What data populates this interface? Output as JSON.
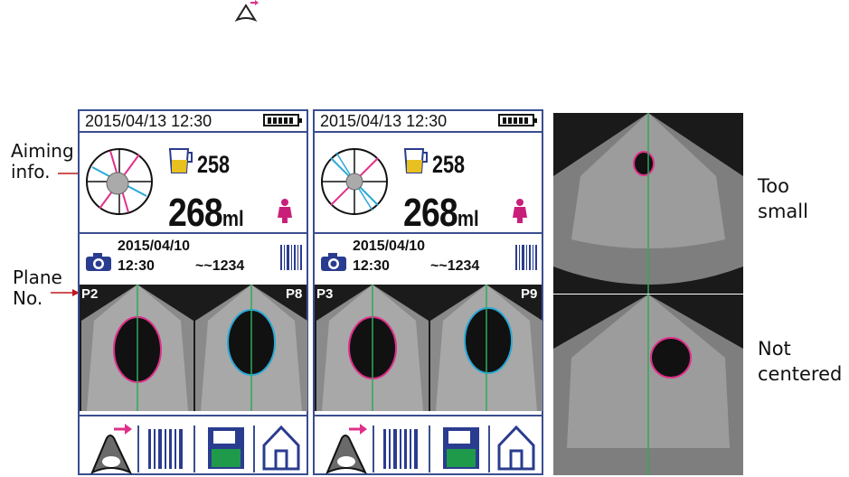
{
  "top_icon": "export-probe-icon",
  "labels": {
    "aiming_line1": "Aiming",
    "aiming_line2": "info.",
    "plane_line1": "Plane",
    "plane_line2": "No.",
    "too_small_line1": "Too",
    "too_small_line2": "small",
    "not_centered_line1": "Not",
    "not_centered_line2": "centered"
  },
  "screens": [
    {
      "datetime": "2015/04/13 12:30",
      "battery_bars": 5,
      "bladder_volume_small": "258",
      "volume_value": "268",
      "volume_unit": "ml",
      "measure_date": "2015/04/10",
      "measure_time": "12:30",
      "patient_id": "~~1234",
      "plane_left": "P2",
      "plane_right": "P8",
      "toolbar": [
        "export-probe-icon",
        "barcode-icon",
        "save-icon",
        "home-icon"
      ]
    },
    {
      "datetime": "2015/04/13 12:30",
      "battery_bars": 5,
      "bladder_volume_small": "258",
      "volume_value": "268",
      "volume_unit": "ml",
      "measure_date": "2015/04/10",
      "measure_time": "12:30",
      "patient_id": "~~1234",
      "plane_left": "P3",
      "plane_right": "P9",
      "toolbar": [
        "export-probe-icon",
        "barcode-icon",
        "save-icon",
        "home-icon"
      ]
    }
  ],
  "colors": {
    "frame": "#3b4e8f",
    "magenta_contour": "#e0308a",
    "cyan_contour": "#29a9d6",
    "center_line": "#2fa85a",
    "save_green": "#1f9a4a",
    "save_blue": "#2a3c8f"
  }
}
